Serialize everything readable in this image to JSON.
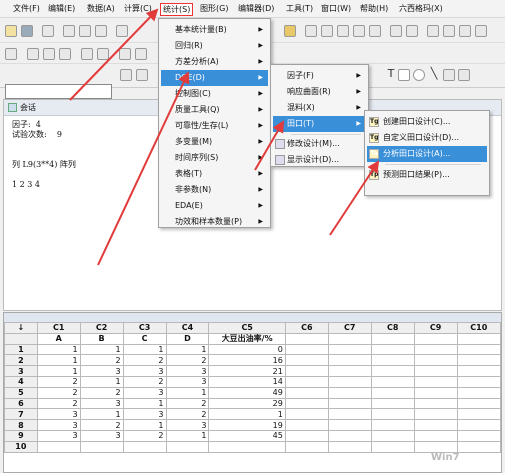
{
  "menubar": [
    "文件(F)",
    "编辑(E)",
    "数据(A)",
    "计算(C)",
    "统计(S)",
    "图形(G)",
    "编辑器(D)",
    "工具(T)",
    "窗口(W)",
    "帮助(H)",
    "六西格玛(X)"
  ],
  "stat_menu": {
    "items": [
      "基本统计量(B)",
      "回归(R)",
      "方差分析(A)",
      "DOE(D)",
      "控制图(C)",
      "质量工具(Q)",
      "可靠性/生存(L)",
      "多变量(M)",
      "时间序列(S)",
      "表格(T)",
      "非参数(N)",
      "EDA(E)",
      "功效和样本数量(P)"
    ],
    "selected": "DOE(D)"
  },
  "doe_menu": {
    "items": [
      "因子(F)",
      "响应曲面(R)",
      "混料(X)",
      "田口(T)",
      "修改设计(M)...",
      "显示设计(D)..."
    ],
    "selected": "田口(T)"
  },
  "taguchi_menu": {
    "items": [
      "创建田口设计(C)...",
      "自定义田口设计(D)...",
      "分析田口设计(A)...",
      "预测田口结果(P)..."
    ],
    "selected": "分析田口设计(A)...",
    "icons": [
      "Tg",
      "Tg",
      "Ta",
      "Tp"
    ]
  },
  "session": {
    "title": "会话",
    "lines": "因子:  4\n试验次数:    9\n\n\n列 L9(3**4) 阵列\n\n1 2 3 4"
  },
  "worksheet": {
    "columns": [
      "C1",
      "C2",
      "C3",
      "C4",
      "C5",
      "C6",
      "C7",
      "C8",
      "C9",
      "C10"
    ],
    "names": [
      "A",
      "B",
      "C",
      "D",
      "大豆出油率/%",
      "",
      "",
      "",
      "",
      ""
    ],
    "rows": [
      [
        1,
        1,
        1,
        1,
        0
      ],
      [
        1,
        2,
        2,
        2,
        16
      ],
      [
        1,
        3,
        3,
        3,
        21
      ],
      [
        2,
        1,
        2,
        3,
        14
      ],
      [
        2,
        2,
        3,
        1,
        49
      ],
      [
        2,
        3,
        1,
        2,
        29
      ],
      [
        3,
        1,
        3,
        2,
        1
      ],
      [
        3,
        2,
        1,
        3,
        19
      ],
      [
        3,
        3,
        2,
        1,
        45
      ],
      [
        "",
        "",
        "",
        "",
        ""
      ]
    ]
  },
  "watermark": "Win7"
}
